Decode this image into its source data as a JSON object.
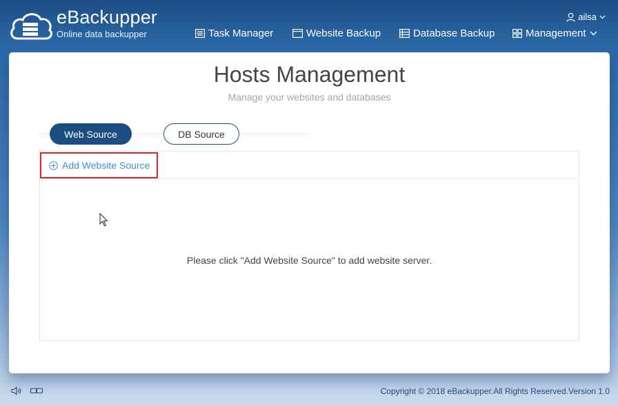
{
  "brand": {
    "name": "eBackupper",
    "subtitle": "Online data backupper"
  },
  "user": {
    "name": "ailsa",
    "icon": "user-icon"
  },
  "nav": [
    {
      "label": "Task Manager",
      "icon": "list-icon"
    },
    {
      "label": "Website Backup",
      "icon": "browser-window-icon"
    },
    {
      "label": "Database Backup",
      "icon": "database-list-icon"
    },
    {
      "label": "Management",
      "icon": "grid-icon"
    }
  ],
  "page": {
    "title": "Hosts Management",
    "subtitle": "Manage your websites and databases"
  },
  "tabs": [
    {
      "label": "Web Source",
      "active": true
    },
    {
      "label": "DB Source",
      "active": false
    }
  ],
  "toolbar": {
    "add_label": "Add Website Source"
  },
  "empty_message": "Please click \"Add Website Source\" to add website server.",
  "footer": {
    "copyright": "Copyright © 2018 eBackupper.All Rights Reserved.Version 1.0"
  },
  "colors": {
    "accent": "#1b4d80",
    "link": "#3d8fd6",
    "highlight": "#e0242a"
  }
}
